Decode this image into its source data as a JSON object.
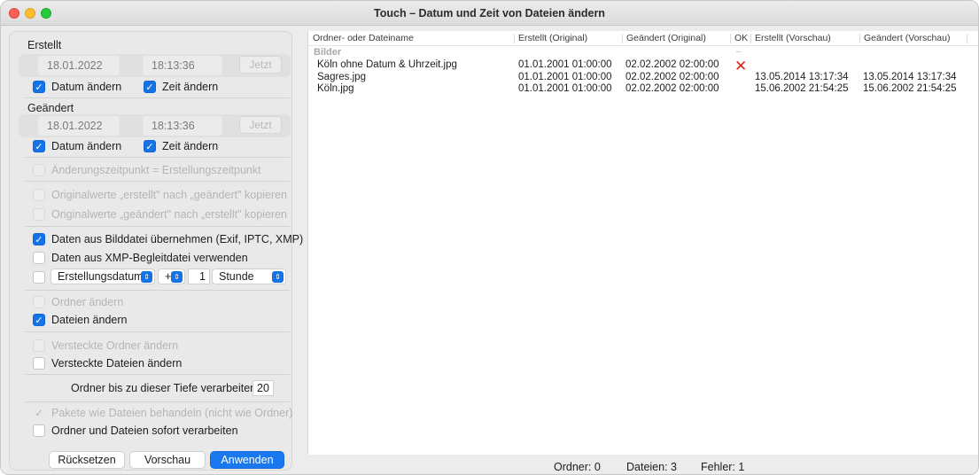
{
  "window": {
    "title": "Touch – Datum und Zeit von Dateien ändern"
  },
  "created": {
    "label": "Erstellt",
    "date": "18.01.2022",
    "time": "18:13:36",
    "now_label": "Jetzt",
    "change_date_label": "Datum ändern",
    "change_time_label": "Zeit ändern",
    "change_date_checked": true,
    "change_time_checked": true
  },
  "modified": {
    "label": "Geändert",
    "date": "18.01.2022",
    "time": "18:13:36",
    "now_label": "Jetzt",
    "change_date_label": "Datum ändern",
    "change_time_label": "Zeit ändern",
    "change_date_checked": true,
    "change_time_checked": true
  },
  "options": {
    "mod_eq_created": "Änderungszeitpunkt = Erstellungszeitpunkt",
    "copy_created_to_modified": "Originalwerte „erstellt\" nach „geändert\" kopieren",
    "copy_modified_to_created": "Originalwerte „geändert\" nach „erstellt\" kopieren",
    "use_image_metadata": "Daten aus Bilddatei übernehmen (Exif, IPTC, XMP)",
    "use_image_metadata_checked": true,
    "use_xmp_sidecar": "Daten aus XMP-Begleitdatei verwenden",
    "use_xmp_sidecar_checked": false,
    "offset_enabled_checked": false,
    "offset_base": "Erstellungsdatum",
    "offset_sign": "+",
    "offset_amount": "1",
    "offset_unit": "Stunde",
    "change_folders": "Ordner ändern",
    "change_files": "Dateien ändern",
    "change_files_checked": true,
    "change_hidden_folders": "Versteckte Ordner ändern",
    "change_hidden_files": "Versteckte Dateien ändern",
    "change_hidden_files_checked": false,
    "depth_label": "Ordner bis zu dieser Tiefe verarbeiten:",
    "depth_value": "20",
    "packages_as_files": "Pakete wie Dateien behandeln (nicht wie Ordner)",
    "packages_as_files_checked": true,
    "process_immediately": "Ordner und Dateien sofort verarbeiten",
    "process_immediately_checked": false
  },
  "buttons": {
    "reset": "Rücksetzen",
    "preview": "Vorschau",
    "apply": "Anwenden"
  },
  "table": {
    "columns": [
      "Ordner- oder Dateiname",
      "Erstellt (Original)",
      "Geändert (Original)",
      "OK",
      "Erstellt (Vorschau)",
      "Geändert (Vorschau)"
    ],
    "group": "Bilder",
    "group_ok": "–",
    "rows": [
      {
        "name": "Köln ohne Datum & Uhrzeit.jpg",
        "created": "01.01.2001  01:00:00",
        "modified": "02.02.2002  02:00:00",
        "ok": "✕",
        "created_preview": "",
        "modified_preview": ""
      },
      {
        "name": "Sagres.jpg",
        "created": "01.01.2001  01:00:00",
        "modified": "02.02.2002  02:00:00",
        "ok": "",
        "created_preview": "13.05.2014  13:17:34",
        "modified_preview": "13.05.2014  13:17:34"
      },
      {
        "name": "Köln.jpg",
        "created": "01.01.2001  01:00:00",
        "modified": "02.02.2002  02:00:00",
        "ok": "",
        "created_preview": "15.06.2002  21:54:25",
        "modified_preview": "15.06.2002  21:54:25"
      }
    ]
  },
  "status": {
    "folders": "Ordner: 0",
    "files": "Dateien: 3",
    "errors": "Fehler: 1"
  },
  "colors": {
    "accent": "#1473e6",
    "error": "#e0241a"
  }
}
